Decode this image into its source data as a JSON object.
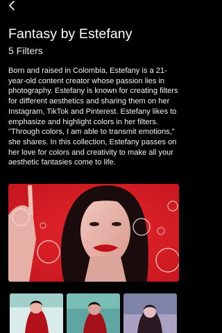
{
  "header": {
    "back_icon": "chevron-left-icon",
    "title": "Fantasy by Estefany",
    "subtitle": "5 Filters"
  },
  "description": "Born and raised in Colombia, Estefany is a 21-year-old content creator whose passion lies in photography. Estefany is known for creating filters for different aesthetics and sharing them on her Instagram, TikTok and Pinterest. Estefany likes to emphasize and highlight colors in her filters. \"Through colors, I am able to transmit emotions,\" she shares. In this collection, Estefany passes on her love for colors and creativity to make all your aesthetic fantasies come to life.",
  "colors": {
    "background": "#000000",
    "hero_red": "#d61e26",
    "thumb_teal": "#5fa6a2"
  }
}
